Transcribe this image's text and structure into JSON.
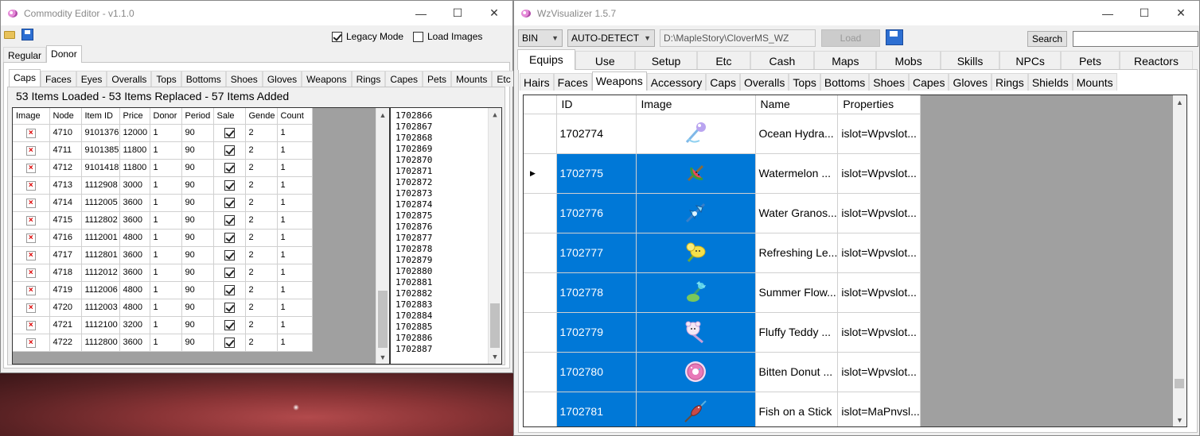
{
  "commodity_editor": {
    "title": "Commodity Editor - v1.1.0",
    "legacy_mode_label": "Legacy Mode",
    "legacy_mode_checked": true,
    "load_images_label": "Load Images",
    "load_images_checked": false,
    "mode_tabs": [
      "Regular",
      "Donor"
    ],
    "active_mode_tab": "Donor",
    "category_tabs": [
      "Caps",
      "Faces",
      "Eyes",
      "Overalls",
      "Tops",
      "Bottoms",
      "Shoes",
      "Gloves",
      "Weapons",
      "Rings",
      "Capes",
      "Pets",
      "Mounts",
      "Etc"
    ],
    "active_category_tab": "Caps",
    "status": "53 Items Loaded - 53 Items Replaced - 57 Items Added",
    "columns": [
      "Image",
      "Node",
      "Item ID",
      "Price",
      "Donor",
      "Period",
      "Sale",
      "Gende",
      "Count"
    ],
    "rows": [
      {
        "node": "4710",
        "item_id": "9101376",
        "price": "12000",
        "donor": "1",
        "period": "90",
        "gender": "2",
        "count": "1"
      },
      {
        "node": "4711",
        "item_id": "9101385",
        "price": "11800",
        "donor": "1",
        "period": "90",
        "gender": "2",
        "count": "1"
      },
      {
        "node": "4712",
        "item_id": "9101418",
        "price": "11800",
        "donor": "1",
        "period": "90",
        "gender": "2",
        "count": "1"
      },
      {
        "node": "4713",
        "item_id": "1112908",
        "price": "3000",
        "donor": "1",
        "period": "90",
        "gender": "2",
        "count": "1"
      },
      {
        "node": "4714",
        "item_id": "1112005",
        "price": "3600",
        "donor": "1",
        "period": "90",
        "gender": "2",
        "count": "1"
      },
      {
        "node": "4715",
        "item_id": "1112802",
        "price": "3600",
        "donor": "1",
        "period": "90",
        "gender": "2",
        "count": "1"
      },
      {
        "node": "4716",
        "item_id": "1112001",
        "price": "4800",
        "donor": "1",
        "period": "90",
        "gender": "2",
        "count": "1"
      },
      {
        "node": "4717",
        "item_id": "1112801",
        "price": "3600",
        "donor": "1",
        "period": "90",
        "gender": "2",
        "count": "1"
      },
      {
        "node": "4718",
        "item_id": "1112012",
        "price": "3600",
        "donor": "1",
        "period": "90",
        "gender": "2",
        "count": "1"
      },
      {
        "node": "4719",
        "item_id": "1112006",
        "price": "4800",
        "donor": "1",
        "period": "90",
        "gender": "2",
        "count": "1"
      },
      {
        "node": "4720",
        "item_id": "1112003",
        "price": "4800",
        "donor": "1",
        "period": "90",
        "gender": "2",
        "count": "1"
      },
      {
        "node": "4721",
        "item_id": "1112100",
        "price": "3200",
        "donor": "1",
        "period": "90",
        "gender": "2",
        "count": "1"
      },
      {
        "node": "4722",
        "item_id": "1112800",
        "price": "3600",
        "donor": "1",
        "period": "90",
        "gender": "2",
        "count": "1"
      }
    ],
    "id_list": [
      "1702866",
      "1702867",
      "1702868",
      "1702869",
      "1702870",
      "1702871",
      "1702872",
      "1702873",
      "1702874",
      "1702875",
      "1702876",
      "1702877",
      "1702878",
      "1702879",
      "1702880",
      "1702881",
      "1702882",
      "1702883",
      "1702884",
      "1702885",
      "1702886",
      "1702887"
    ]
  },
  "wz": {
    "title": "WzVisualizer 1.5.7",
    "format_select": "BIN",
    "region_select": "AUTO-DETECT",
    "path": "D:\\MapleStory\\CloverMS_WZ",
    "load_label": "Load",
    "search_label": "Search",
    "search_value": "",
    "main_tabs": [
      "Equips",
      "Use",
      "Setup",
      "Etc",
      "Cash",
      "Maps",
      "Mobs",
      "Skills",
      "NPCs",
      "Pets",
      "Reactors"
    ],
    "active_main_tab": "Equips",
    "sub_tabs": [
      "Hairs",
      "Faces",
      "Weapons",
      "Accessory",
      "Caps",
      "Overalls",
      "Tops",
      "Bottoms",
      "Shoes",
      "Capes",
      "Gloves",
      "Rings",
      "Shields",
      "Mounts"
    ],
    "active_sub_tab": "Weapons",
    "columns": [
      "ID",
      "Image",
      "Name",
      "Properties"
    ],
    "rows": [
      {
        "id": "1702774",
        "name": "Ocean Hydra...",
        "properties": "islot=Wpvslot...",
        "selected": false,
        "icon": "ocean-hydra-icon"
      },
      {
        "id": "1702775",
        "name": "Watermelon ...",
        "properties": "islot=Wpvslot...",
        "selected": true,
        "current": true,
        "icon": "watermelon-icon"
      },
      {
        "id": "1702776",
        "name": "Water Granos...",
        "properties": "islot=Wpvslot...",
        "selected": true,
        "icon": "water-granos-icon"
      },
      {
        "id": "1702777",
        "name": "Refreshing Le...",
        "properties": "islot=Wpvslot...",
        "selected": true,
        "icon": "lemon-icon"
      },
      {
        "id": "1702778",
        "name": "Summer Flow...",
        "properties": "islot=Wpvslot...",
        "selected": true,
        "icon": "summer-flower-icon"
      },
      {
        "id": "1702779",
        "name": "Fluffy Teddy ...",
        "properties": "islot=Wpvslot...",
        "selected": true,
        "icon": "teddy-icon"
      },
      {
        "id": "1702780",
        "name": "Bitten Donut ...",
        "properties": "islot=Wpvslot...",
        "selected": true,
        "icon": "donut-icon"
      },
      {
        "id": "1702781",
        "name": "Fish on a Stick",
        "properties": "islot=MaPnvsl...",
        "selected": true,
        "icon": "fish-stick-icon"
      }
    ]
  }
}
